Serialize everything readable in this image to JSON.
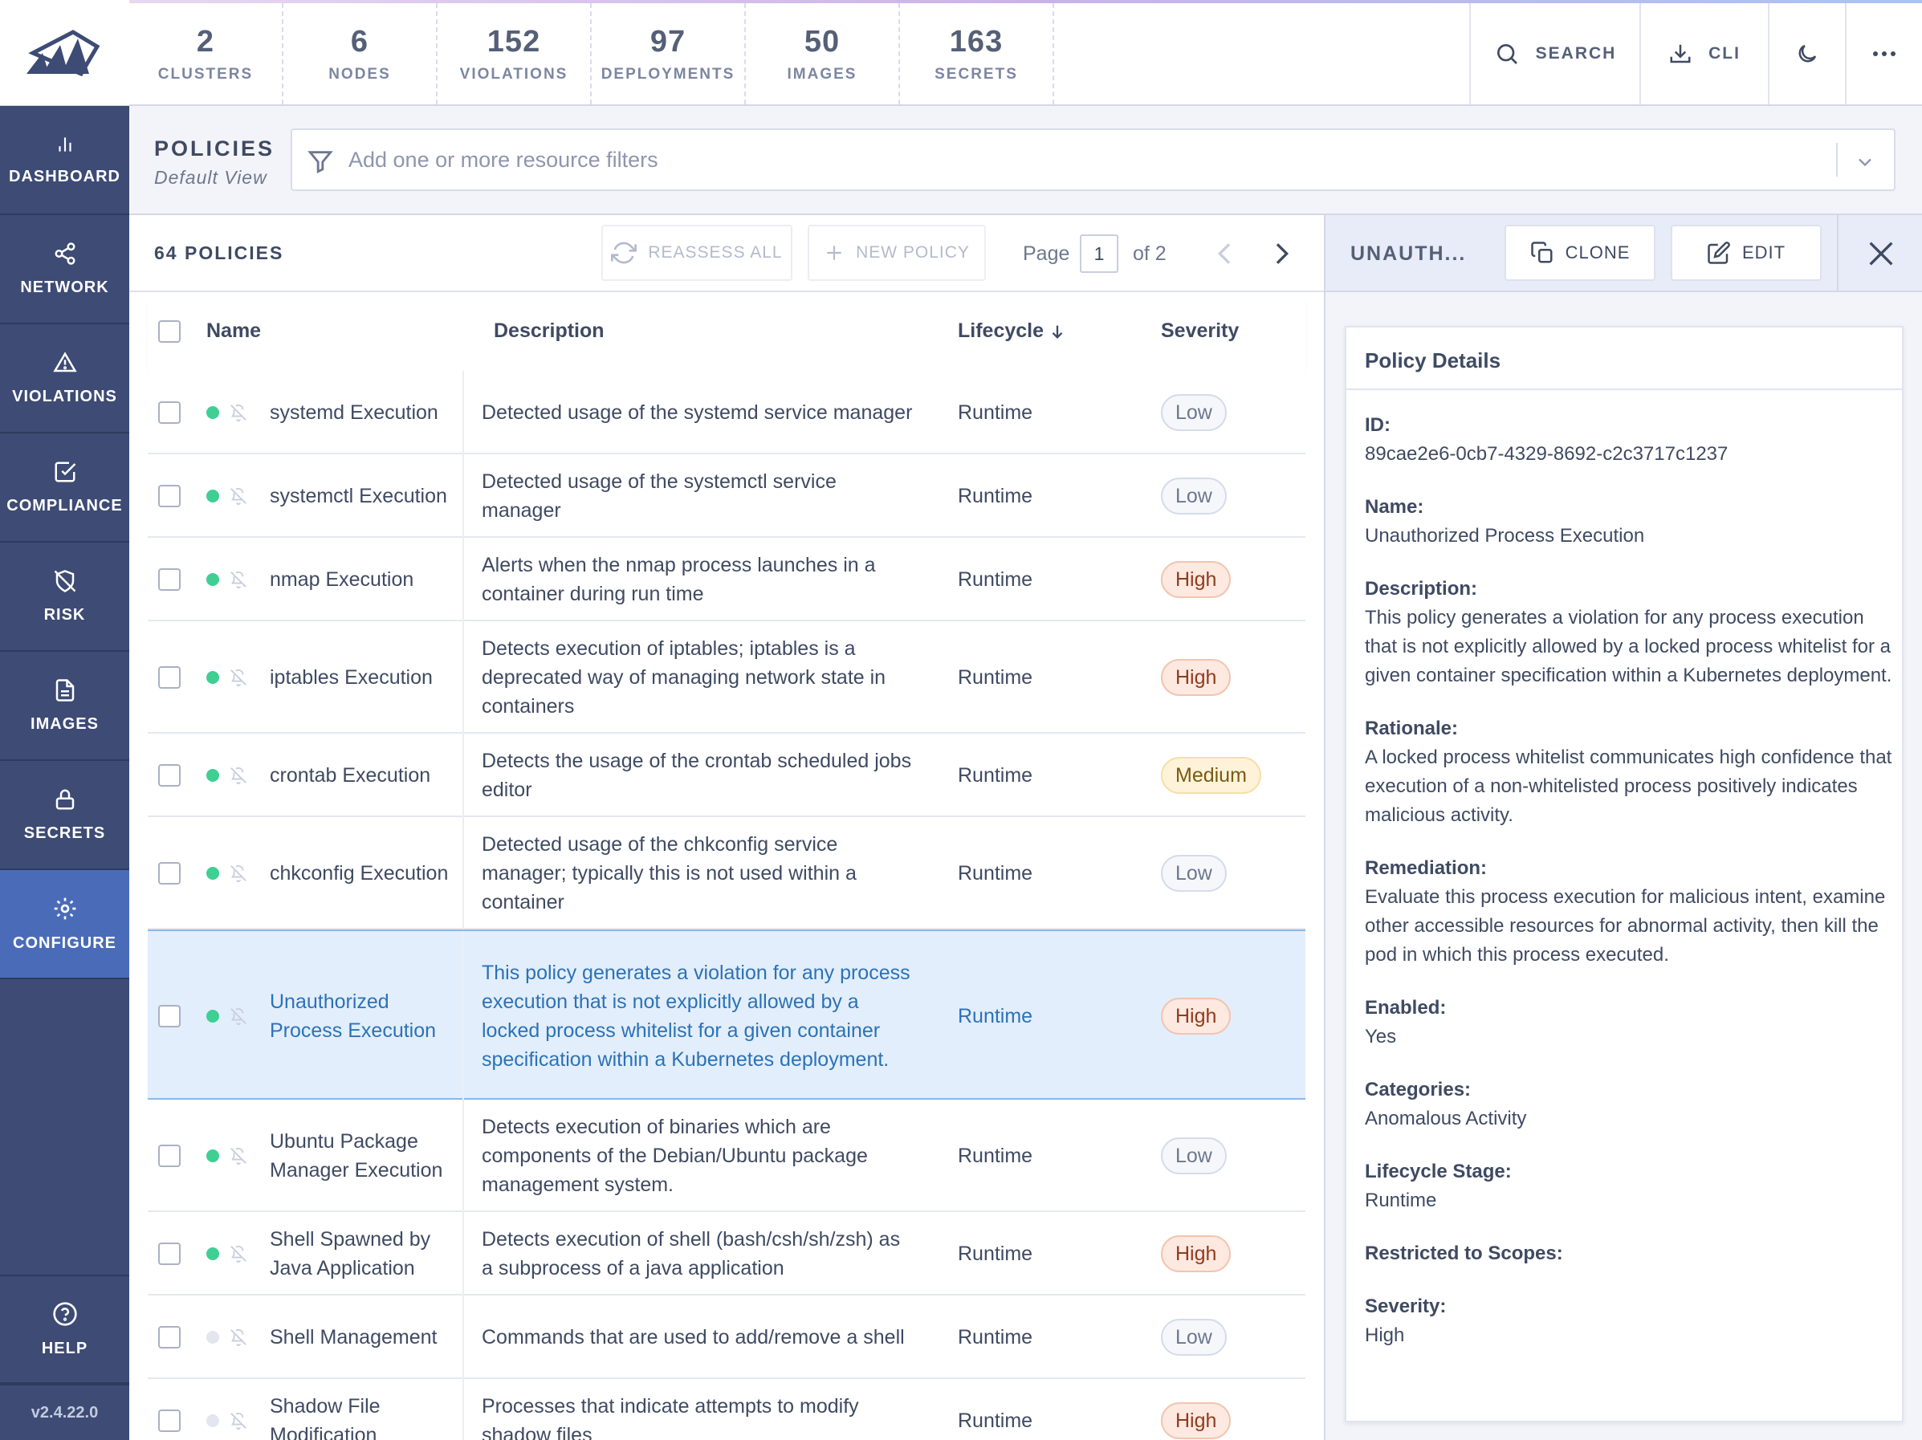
{
  "stats": [
    {
      "value": "2",
      "label": "CLUSTERS"
    },
    {
      "value": "6",
      "label": "NODES"
    },
    {
      "value": "152",
      "label": "VIOLATIONS"
    },
    {
      "value": "97",
      "label": "DEPLOYMENTS"
    },
    {
      "value": "50",
      "label": "IMAGES"
    },
    {
      "value": "163",
      "label": "SECRETS"
    }
  ],
  "topbar": {
    "search_label": "SEARCH",
    "cli_label": "CLI"
  },
  "nav": [
    {
      "label": "DASHBOARD",
      "icon": "bar-chart-icon"
    },
    {
      "label": "NETWORK",
      "icon": "share-icon"
    },
    {
      "label": "VIOLATIONS",
      "icon": "alert-triangle-icon"
    },
    {
      "label": "COMPLIANCE",
      "icon": "check-square-icon"
    },
    {
      "label": "RISK",
      "icon": "shield-off-icon"
    },
    {
      "label": "IMAGES",
      "icon": "file-icon"
    },
    {
      "label": "SECRETS",
      "icon": "lock-icon"
    },
    {
      "label": "CONFIGURE",
      "icon": "gear-icon",
      "active": true
    }
  ],
  "help_label": "HELP",
  "version": "v2.4.22.0",
  "page": {
    "title": "POLICIES",
    "subtitle": "Default View"
  },
  "filter": {
    "placeholder": "Add one or more resource filters"
  },
  "list": {
    "count_label": "64 POLICIES",
    "reassess_label": "REASSESS ALL",
    "new_policy_label": "NEW POLICY",
    "page_label": "Page",
    "page_value": "1",
    "page_of": "of 2"
  },
  "columns": {
    "name": "Name",
    "description": "Description",
    "lifecycle": "Lifecycle",
    "severity": "Severity"
  },
  "rows": [
    {
      "name": "systemd Execution",
      "description": "Detected usage of the systemd service manager",
      "lifecycle": "Runtime",
      "severity": "Low",
      "enabled": true
    },
    {
      "name": "systemctl Execution",
      "description": "Detected usage of the systemctl service manager",
      "lifecycle": "Runtime",
      "severity": "Low",
      "enabled": true
    },
    {
      "name": "nmap Execution",
      "description": "Alerts when the nmap process launches in a container during run time",
      "lifecycle": "Runtime",
      "severity": "High",
      "enabled": true
    },
    {
      "name": "iptables Execution",
      "description": "Detects execution of iptables; iptables is a deprecated way of managing network state in containers",
      "lifecycle": "Runtime",
      "severity": "High",
      "enabled": true
    },
    {
      "name": "crontab Execution",
      "description": "Detects the usage of the crontab scheduled jobs editor",
      "lifecycle": "Runtime",
      "severity": "Medium",
      "enabled": true
    },
    {
      "name": "chkconfig Execution",
      "description": "Detected usage of the chkconfig service manager; typically this is not used within a container",
      "lifecycle": "Runtime",
      "severity": "Low",
      "enabled": true
    },
    {
      "name": "Unauthorized Process Execution",
      "description": "This policy generates a violation for any process execution that is not explicitly allowed by a locked process whitelist for a given container specification within a Kubernetes deployment.",
      "lifecycle": "Runtime",
      "severity": "High",
      "enabled": true,
      "selected": true
    },
    {
      "name": "Ubuntu Package Manager Execution",
      "description": "Detects execution of binaries which are components of the Debian/Ubuntu package management system.",
      "lifecycle": "Runtime",
      "severity": "Low",
      "enabled": true
    },
    {
      "name": "Shell Spawned by Java Application",
      "description": "Detects execution of shell (bash/csh/sh/zsh) as a subprocess of a java application",
      "lifecycle": "Runtime",
      "severity": "High",
      "enabled": true
    },
    {
      "name": "Shell Management",
      "description": "Commands that are used to add/remove a shell",
      "lifecycle": "Runtime",
      "severity": "Low",
      "enabled": false
    },
    {
      "name": "Shadow File Modification",
      "description": "Processes that indicate attempts to modify shadow files",
      "lifecycle": "Runtime",
      "severity": "High",
      "enabled": false
    }
  ],
  "detail": {
    "header_title": "UNAUTH...",
    "clone_label": "CLONE",
    "edit_label": "EDIT",
    "card_title": "Policy Details",
    "fields": [
      {
        "label": "ID:",
        "value": "89cae2e6-0cb7-4329-8692-c2c3717c1237"
      },
      {
        "label": "Name:",
        "value": "Unauthorized Process Execution"
      },
      {
        "label": "Description:",
        "value": "This policy generates a violation for any process execution that is not explicitly allowed by a locked process whitelist for a given container specification within a Kubernetes deployment."
      },
      {
        "label": "Rationale:",
        "value": "A locked process whitelist communicates high confidence that execution of a non-whitelisted process positively indicates malicious activity."
      },
      {
        "label": "Remediation:",
        "value": "Evaluate this process execution for malicious intent, examine other accessible resources for abnormal activity, then kill the pod in which this process executed."
      },
      {
        "label": "Enabled:",
        "value": "Yes"
      },
      {
        "label": "Categories:",
        "value": "Anomalous Activity"
      },
      {
        "label": "Lifecycle Stage:",
        "value": "Runtime"
      },
      {
        "label": "Restricted to Scopes:",
        "value": ""
      },
      {
        "label": "Severity:",
        "value": "High"
      }
    ]
  },
  "colors": {
    "sidebar": "#3d4b75",
    "sidebar_active": "#4a6cb8",
    "selected_row": "#e2eefb",
    "selected_text": "#2c72b8",
    "enabled_dot": "#3fcf94",
    "disabled_dot": "#e3e6ef"
  }
}
